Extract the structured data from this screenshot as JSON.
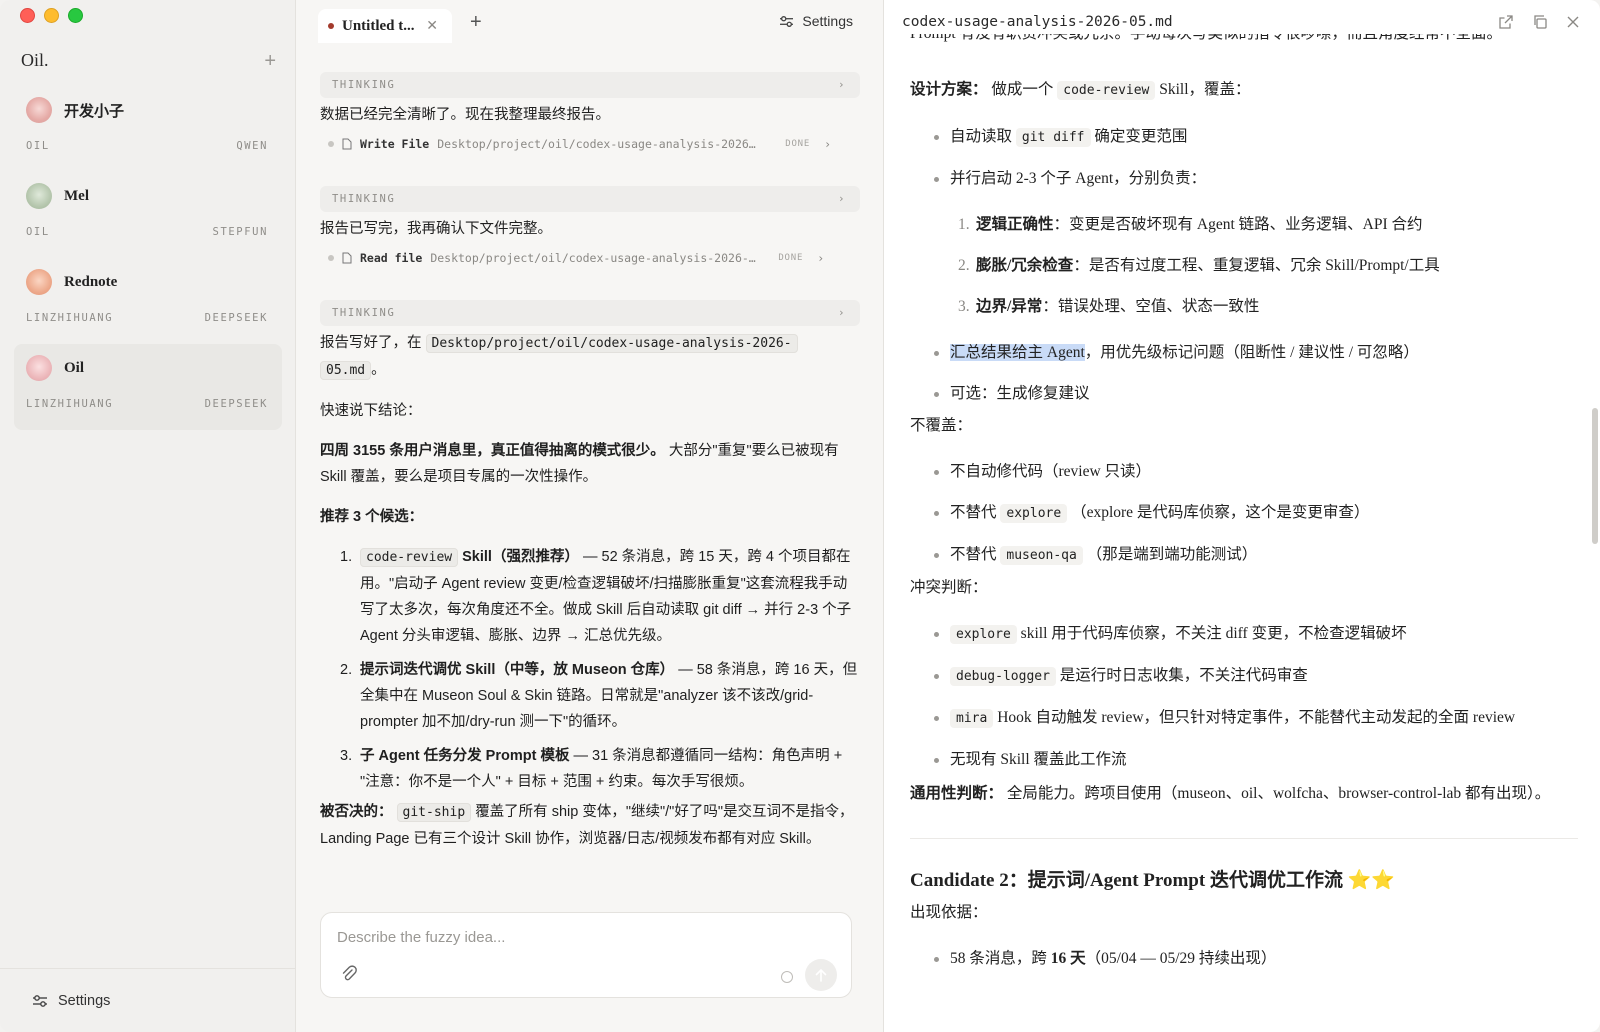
{
  "window": {
    "brand": "Oil.",
    "add_label": "+"
  },
  "sidebar": {
    "agents": [
      {
        "name": "开发小子",
        "left_meta": "OIL",
        "right_meta": "QWEN",
        "avatar_color": "#e7b4b4"
      },
      {
        "name": "Mel",
        "left_meta": "OIL",
        "right_meta": "STEPFUN",
        "avatar_color": "#bfcfb9"
      },
      {
        "name": "Rednote",
        "left_meta": "LINZHIHUANG",
        "right_meta": "DEEPSEEK",
        "avatar_color": "#f0b59f"
      },
      {
        "name": "Oil",
        "left_meta": "LINZHIHUANG",
        "right_meta": "DEEPSEEK",
        "avatar_color": "#efc1c4"
      }
    ],
    "settings_label": "Settings"
  },
  "chat": {
    "tab_title": "Untitled t...",
    "tab_close": "✕",
    "tab_add": "+",
    "settings_label": "Settings",
    "thinking_label": "THINKING",
    "msg1": "数据已经完全清晰了。现在我整理最终报告。",
    "tool1": {
      "name": "Write File",
      "path": "Desktop/project/oil/codex-usage-analysis-2026…",
      "status": "DONE"
    },
    "msg2": "报告已写完，我再确认下文件完整。",
    "tool2": {
      "name": "Read file",
      "path": "Desktop/project/oil/codex-usage-analysis-2026-…",
      "status": "DONE"
    },
    "msg3_prefix": "报告写好了，在",
    "msg3_path_a": "Desktop/project/oil/codex-usage-analysis-2026-",
    "msg3_path_b": "05.md",
    "msg3_suffix": "。",
    "quick": "快速说下结论：",
    "summary_bold": "四周 3155 条用户消息里，真正值得抽离的模式很少。",
    "summary_rest": "大部分\"重复\"要么已被现有 Skill 覆盖，要么是项目专属的一次性操作。",
    "recommend": "推荐 3 个候选：",
    "items": [
      {
        "num": "1.",
        "code": "code-review",
        "bold": "Skill（强烈推荐）",
        "text": "— 52 条消息，跨 15 天，跨 4 个项目都在用。\"启动子 Agent review 变更/检查逻辑破坏/扫描膨胀重复\"这套流程我手动写了太多次，每次角度还不全。做成 Skill 后自动读取 git diff → 并行 2-3 个子 Agent 分头审逻辑、膨胀、边界 → 汇总优先级。"
      },
      {
        "num": "2.",
        "code": "",
        "bold": "提示词迭代调优 Skill（中等，放 Museon 仓库）",
        "text": "— 58 条消息，跨 16 天，但全集中在 Museon Soul & Skin 链路。日常就是\"analyzer 该不该改/grid-prompter 加不加/dry-run 测一下\"的循环。"
      },
      {
        "num": "3.",
        "code": "",
        "bold": "子 Agent 任务分发 Prompt 模板",
        "text": "— 31 条消息都遵循同一结构：角色声明 + \"注意：你不是一个人\" + 目标 + 范围 + 约束。每次手写很烦。"
      }
    ],
    "rejected_label": "被否决的：",
    "rejected_code": "git-ship",
    "rejected_text": "覆盖了所有 ship 变体，\"继续\"/\"好了吗\"是交互词不是指令，Landing Page 已有三个设计 Skill 协作，浏览器/日志/视频发布都有对应 Skill。",
    "composer_placeholder": "Describe the fuzzy idea..."
  },
  "doc": {
    "filename": "codex-usage-analysis-2026-05.md",
    "top_cut": "Prompt 有没有职责冲突或冗余。手动每次写类似的指令很啰嗦，而且角度经常不全面。",
    "design_label": "设计方案：",
    "design_text_a": "做成一个",
    "design_code": "code-review",
    "design_text_b": "Skill，覆盖：",
    "bullets1": [
      {
        "pre": "自动读取",
        "code": "git diff",
        "post": "确定变更范围"
      },
      {
        "pre": "并行启动 2-3 个子 Agent，分别负责：",
        "code": "",
        "post": ""
      }
    ],
    "sub_items": [
      {
        "num": "1.",
        "bold": "逻辑正确性",
        "text": "：变更是否破坏现有 Agent 链路、业务逻辑、API 合约"
      },
      {
        "num": "2.",
        "bold": "膨胀/冗余检查",
        "text": "：是否有过度工程、重复逻辑、冗余 Skill/Prompt/工具"
      },
      {
        "num": "3.",
        "bold": "边界/异常",
        "text": "：错误处理、空值、状态一致性"
      }
    ],
    "bullets2_hl": "汇总结果给主 Agent",
    "bullets2_rest": "，用优先级标记问题（阻断性 / 建议性 / 可忽略）",
    "bullets2_b": "可选：生成修复建议",
    "not_cover": "不覆盖：",
    "not_cover_items": [
      {
        "pre": "不自动修代码（review 只读）",
        "code": "",
        "post": ""
      },
      {
        "pre": "不替代",
        "code": "explore",
        "post": "（explore 是代码库侦察，这个是变更审查）"
      },
      {
        "pre": "不替代",
        "code": "museon-qa",
        "post": "（那是端到端功能测试）"
      }
    ],
    "conflict": "冲突判断：",
    "conflict_items": [
      {
        "code": "explore",
        "post": "skill 用于代码库侦察，不关注 diff 变更，不检查逻辑破坏"
      },
      {
        "code": "debug-logger",
        "post": "是运行时日志收集，不关注代码审查"
      },
      {
        "code": "mira",
        "post": "Hook 自动触发 review，但只针对特定事件，不能替代主动发起的全面 review"
      },
      {
        "code": "",
        "post": "无现有 Skill 覆盖此工作流"
      }
    ],
    "general_label": "通用性判断：",
    "general_text": "全局能力。跨项目使用（museon、oil、wolfcha、browser-control-lab 都有出现）。",
    "candidate2_title": "Candidate 2：提示词/Agent Prompt 迭代调优工作流 ⭐⭐",
    "evidence": "出现依据：",
    "evidence_pre": "58 条消息，跨 ",
    "evidence_bold": "16 天",
    "evidence_post": "（05/04 — 05/29 持续出现）"
  }
}
